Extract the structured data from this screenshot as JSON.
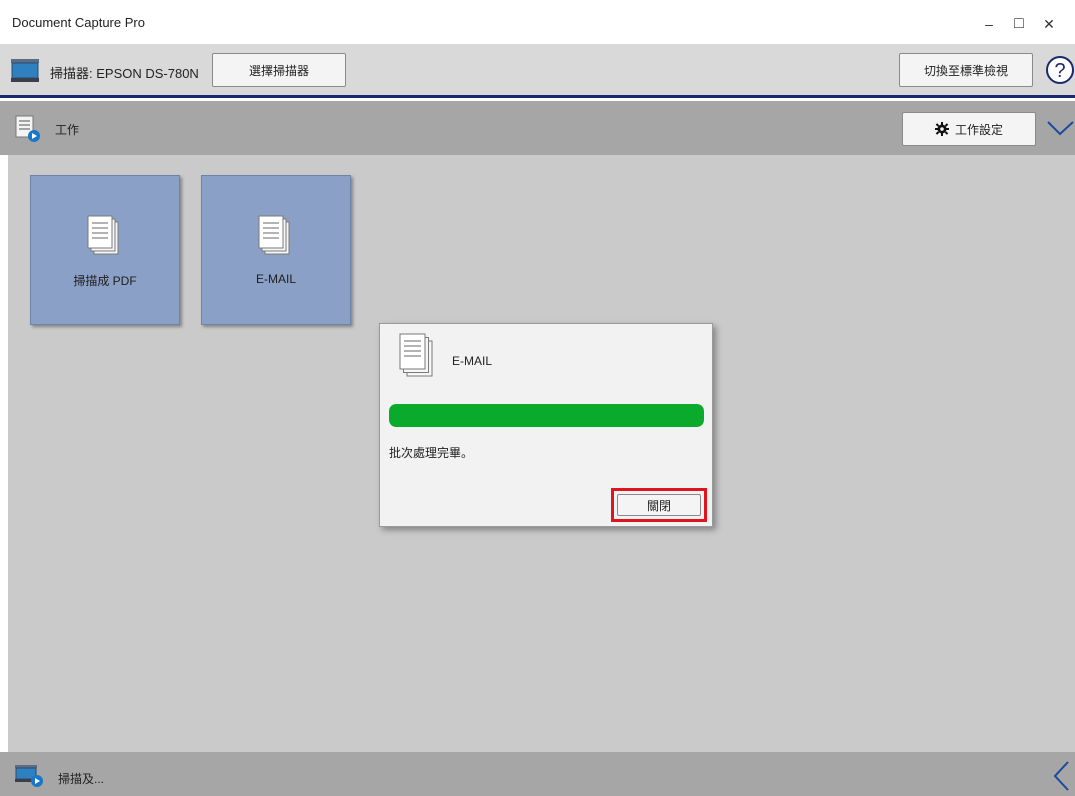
{
  "window": {
    "title": "Document Capture Pro",
    "minimize_glyph": "–",
    "maximize_glyph": "□",
    "close_glyph": "✕"
  },
  "scanner_bar": {
    "label": "掃描器: EPSON DS-780N",
    "select_button": "選擇掃描器",
    "switch_button": "切換至標準檢視",
    "help_icon": "question-circle-icon"
  },
  "jobs_bar": {
    "label": "工作",
    "settings_button": "工作設定",
    "collapse_icon": "chevron-down-icon"
  },
  "jobs": [
    {
      "label": "掃描成 PDF",
      "icon": "document-stack-icon"
    },
    {
      "label": "E-MAIL",
      "icon": "document-stack-icon"
    }
  ],
  "dialog": {
    "title": "E-MAIL",
    "progress_percent": 100,
    "status": "批次處理完畢。",
    "close_button": "關閉"
  },
  "bottom_bar": {
    "label": "掃描及...",
    "expand_icon": "chevron-left-icon"
  },
  "colors": {
    "tile": "#8aa0c6",
    "progress": "#0aab2c",
    "highlight": "#e0141e",
    "divider": "#1a2a6c"
  }
}
